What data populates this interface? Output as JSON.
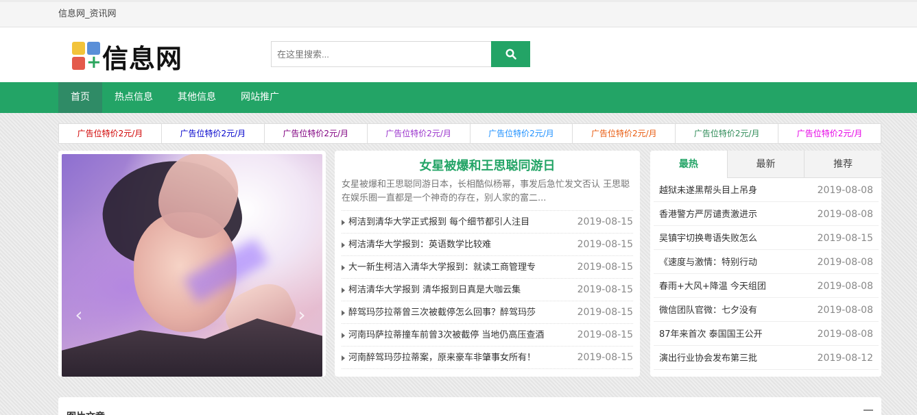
{
  "topbar": {
    "site_title": "信息网_资讯网"
  },
  "logo": {
    "text": "信息网",
    "plus": "+"
  },
  "search": {
    "placeholder": "在这里搜索...",
    "button_icon": "search-icon"
  },
  "nav": {
    "items": [
      "首页",
      "热点信息",
      "其他信息",
      "网站推广"
    ]
  },
  "ads": [
    {
      "label": "广告位特价2元/月",
      "color": "#d00000"
    },
    {
      "label": "广告位特价2元/月",
      "color": "#0000cc"
    },
    {
      "label": "广告位特价2元/月",
      "color": "#800080"
    },
    {
      "label": "广告位特价2元/月",
      "color": "#9932cc"
    },
    {
      "label": "广告位特价2元/月",
      "color": "#1e90ff"
    },
    {
      "label": "广告位特价2元/月",
      "color": "#e8590c"
    },
    {
      "label": "广告位特价2元/月",
      "color": "#2e8b57"
    },
    {
      "label": "广告位特价2元/月",
      "color": "#e600e6"
    }
  ],
  "slider": {
    "prev": "‹",
    "next": "›"
  },
  "headline": {
    "title": "女星被爆和王思聪同游日",
    "summary": "女星被爆和王思聪同游日本，长相酷似杨幂，事发后急忙发文否认 王思聪在娱乐圈一直都是一个神奇的存在，别人家的富二..."
  },
  "news_list": [
    {
      "title": "柯洁到清华大学正式报到 每个细节都引人注目",
      "date": "2019-08-15"
    },
    {
      "title": "柯洁清华大学报到：英语数学比较难",
      "date": "2019-08-15"
    },
    {
      "title": "大一新生柯洁入清华大学报到：就读工商管理专",
      "date": "2019-08-15"
    },
    {
      "title": "柯洁清华大学报到 清华报到日真是大咖云集",
      "date": "2019-08-15"
    },
    {
      "title": "醉驾玛莎拉蒂曾三次被截停怎么回事？醉驾玛莎",
      "date": "2019-08-15"
    },
    {
      "title": "河南玛萨拉蒂撞车前曾3次被截停 当地仍高压查酒",
      "date": "2019-08-15"
    },
    {
      "title": "河南醉驾玛莎拉蒂案，原来豪车非肇事女所有！",
      "date": "2019-08-15"
    }
  ],
  "tabs": {
    "items": [
      "最热",
      "最新",
      "推荐"
    ],
    "active": "最热"
  },
  "hot_list": [
    {
      "title": "越狱未遂黑帮头目上吊身",
      "date": "2019-08-08"
    },
    {
      "title": "香港警方严厉谴责激进示",
      "date": "2019-08-08"
    },
    {
      "title": "吴镇宇切换粤语失败怎么",
      "date": "2019-08-15"
    },
    {
      "title": "《速度与激情：特别行动",
      "date": "2019-08-08"
    },
    {
      "title": "春雨+大风+降温 今天组团",
      "date": "2019-08-08"
    },
    {
      "title": "微信团队官微：七夕没有",
      "date": "2019-08-08"
    },
    {
      "title": "87年来首次 泰国国王公开",
      "date": "2019-08-08"
    },
    {
      "title": "演出行业协会发布第三批",
      "date": "2019-08-12"
    }
  ],
  "pic_section": {
    "title": "图片文章"
  },
  "colors": {
    "brand_green": "#23a466",
    "nav_active": "#2f8b66"
  }
}
